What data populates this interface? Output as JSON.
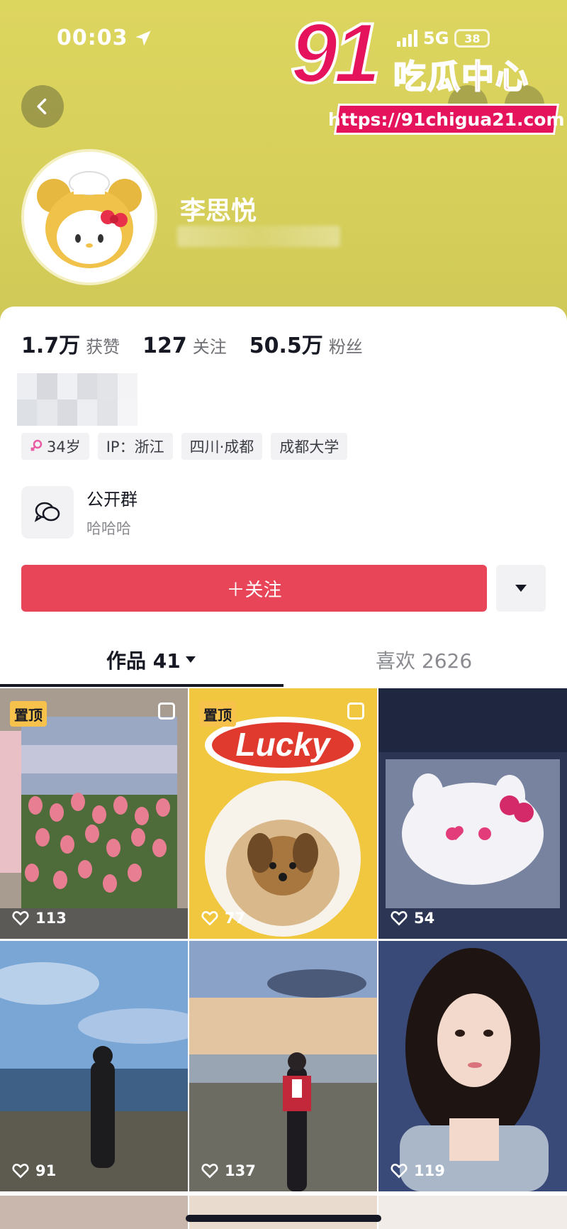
{
  "status_bar": {
    "time": "00:03",
    "network": "5G",
    "battery": "38"
  },
  "watermark": {
    "number": "91",
    "brand": "吃瓜中心",
    "url": "https://91chigua21.com"
  },
  "profile": {
    "name": "李思悦"
  },
  "stats": [
    {
      "value": "1.7万",
      "label": "获赞"
    },
    {
      "value": "127",
      "label": "关注"
    },
    {
      "value": "50.5万",
      "label": "粉丝"
    }
  ],
  "tags": {
    "age": "34岁",
    "ip": "IP：浙江",
    "region": "四川·成都",
    "school": "成都大学"
  },
  "group": {
    "title": "公开群",
    "subtitle": "哈哈哈"
  },
  "follow_button": "＋关注",
  "tabs": {
    "works": "作品 41",
    "likes": "喜欢 2626"
  },
  "pinned_label": "置顶",
  "posts": [
    {
      "likes": "113",
      "pinned": true
    },
    {
      "likes": "77",
      "pinned": true
    },
    {
      "likes": "54",
      "pinned": false
    },
    {
      "likes": "91",
      "pinned": false
    },
    {
      "likes": "137",
      "pinned": false
    },
    {
      "likes": "119",
      "pinned": false
    }
  ],
  "colors": {
    "header_yellow": "#dcd55e",
    "follow_red": "#e84658",
    "watermark_pink": "#e4135b",
    "pin_yellow": "#f6c24b"
  }
}
